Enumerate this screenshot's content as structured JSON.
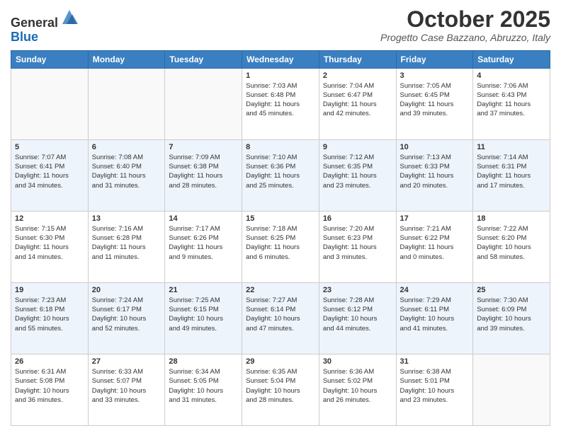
{
  "header": {
    "logo_line1": "General",
    "logo_line2": "Blue",
    "month": "October 2025",
    "location": "Progetto Case Bazzano, Abruzzo, Italy"
  },
  "days_of_week": [
    "Sunday",
    "Monday",
    "Tuesday",
    "Wednesday",
    "Thursday",
    "Friday",
    "Saturday"
  ],
  "weeks": [
    [
      {
        "day": "",
        "info": ""
      },
      {
        "day": "",
        "info": ""
      },
      {
        "day": "",
        "info": ""
      },
      {
        "day": "1",
        "info": "Sunrise: 7:03 AM\nSunset: 6:48 PM\nDaylight: 11 hours\nand 45 minutes."
      },
      {
        "day": "2",
        "info": "Sunrise: 7:04 AM\nSunset: 6:47 PM\nDaylight: 11 hours\nand 42 minutes."
      },
      {
        "day": "3",
        "info": "Sunrise: 7:05 AM\nSunset: 6:45 PM\nDaylight: 11 hours\nand 39 minutes."
      },
      {
        "day": "4",
        "info": "Sunrise: 7:06 AM\nSunset: 6:43 PM\nDaylight: 11 hours\nand 37 minutes."
      }
    ],
    [
      {
        "day": "5",
        "info": "Sunrise: 7:07 AM\nSunset: 6:41 PM\nDaylight: 11 hours\nand 34 minutes."
      },
      {
        "day": "6",
        "info": "Sunrise: 7:08 AM\nSunset: 6:40 PM\nDaylight: 11 hours\nand 31 minutes."
      },
      {
        "day": "7",
        "info": "Sunrise: 7:09 AM\nSunset: 6:38 PM\nDaylight: 11 hours\nand 28 minutes."
      },
      {
        "day": "8",
        "info": "Sunrise: 7:10 AM\nSunset: 6:36 PM\nDaylight: 11 hours\nand 25 minutes."
      },
      {
        "day": "9",
        "info": "Sunrise: 7:12 AM\nSunset: 6:35 PM\nDaylight: 11 hours\nand 23 minutes."
      },
      {
        "day": "10",
        "info": "Sunrise: 7:13 AM\nSunset: 6:33 PM\nDaylight: 11 hours\nand 20 minutes."
      },
      {
        "day": "11",
        "info": "Sunrise: 7:14 AM\nSunset: 6:31 PM\nDaylight: 11 hours\nand 17 minutes."
      }
    ],
    [
      {
        "day": "12",
        "info": "Sunrise: 7:15 AM\nSunset: 6:30 PM\nDaylight: 11 hours\nand 14 minutes."
      },
      {
        "day": "13",
        "info": "Sunrise: 7:16 AM\nSunset: 6:28 PM\nDaylight: 11 hours\nand 11 minutes."
      },
      {
        "day": "14",
        "info": "Sunrise: 7:17 AM\nSunset: 6:26 PM\nDaylight: 11 hours\nand 9 minutes."
      },
      {
        "day": "15",
        "info": "Sunrise: 7:18 AM\nSunset: 6:25 PM\nDaylight: 11 hours\nand 6 minutes."
      },
      {
        "day": "16",
        "info": "Sunrise: 7:20 AM\nSunset: 6:23 PM\nDaylight: 11 hours\nand 3 minutes."
      },
      {
        "day": "17",
        "info": "Sunrise: 7:21 AM\nSunset: 6:22 PM\nDaylight: 11 hours\nand 0 minutes."
      },
      {
        "day": "18",
        "info": "Sunrise: 7:22 AM\nSunset: 6:20 PM\nDaylight: 10 hours\nand 58 minutes."
      }
    ],
    [
      {
        "day": "19",
        "info": "Sunrise: 7:23 AM\nSunset: 6:18 PM\nDaylight: 10 hours\nand 55 minutes."
      },
      {
        "day": "20",
        "info": "Sunrise: 7:24 AM\nSunset: 6:17 PM\nDaylight: 10 hours\nand 52 minutes."
      },
      {
        "day": "21",
        "info": "Sunrise: 7:25 AM\nSunset: 6:15 PM\nDaylight: 10 hours\nand 49 minutes."
      },
      {
        "day": "22",
        "info": "Sunrise: 7:27 AM\nSunset: 6:14 PM\nDaylight: 10 hours\nand 47 minutes."
      },
      {
        "day": "23",
        "info": "Sunrise: 7:28 AM\nSunset: 6:12 PM\nDaylight: 10 hours\nand 44 minutes."
      },
      {
        "day": "24",
        "info": "Sunrise: 7:29 AM\nSunset: 6:11 PM\nDaylight: 10 hours\nand 41 minutes."
      },
      {
        "day": "25",
        "info": "Sunrise: 7:30 AM\nSunset: 6:09 PM\nDaylight: 10 hours\nand 39 minutes."
      }
    ],
    [
      {
        "day": "26",
        "info": "Sunrise: 6:31 AM\nSunset: 5:08 PM\nDaylight: 10 hours\nand 36 minutes."
      },
      {
        "day": "27",
        "info": "Sunrise: 6:33 AM\nSunset: 5:07 PM\nDaylight: 10 hours\nand 33 minutes."
      },
      {
        "day": "28",
        "info": "Sunrise: 6:34 AM\nSunset: 5:05 PM\nDaylight: 10 hours\nand 31 minutes."
      },
      {
        "day": "29",
        "info": "Sunrise: 6:35 AM\nSunset: 5:04 PM\nDaylight: 10 hours\nand 28 minutes."
      },
      {
        "day": "30",
        "info": "Sunrise: 6:36 AM\nSunset: 5:02 PM\nDaylight: 10 hours\nand 26 minutes."
      },
      {
        "day": "31",
        "info": "Sunrise: 6:38 AM\nSunset: 5:01 PM\nDaylight: 10 hours\nand 23 minutes."
      },
      {
        "day": "",
        "info": ""
      }
    ]
  ]
}
